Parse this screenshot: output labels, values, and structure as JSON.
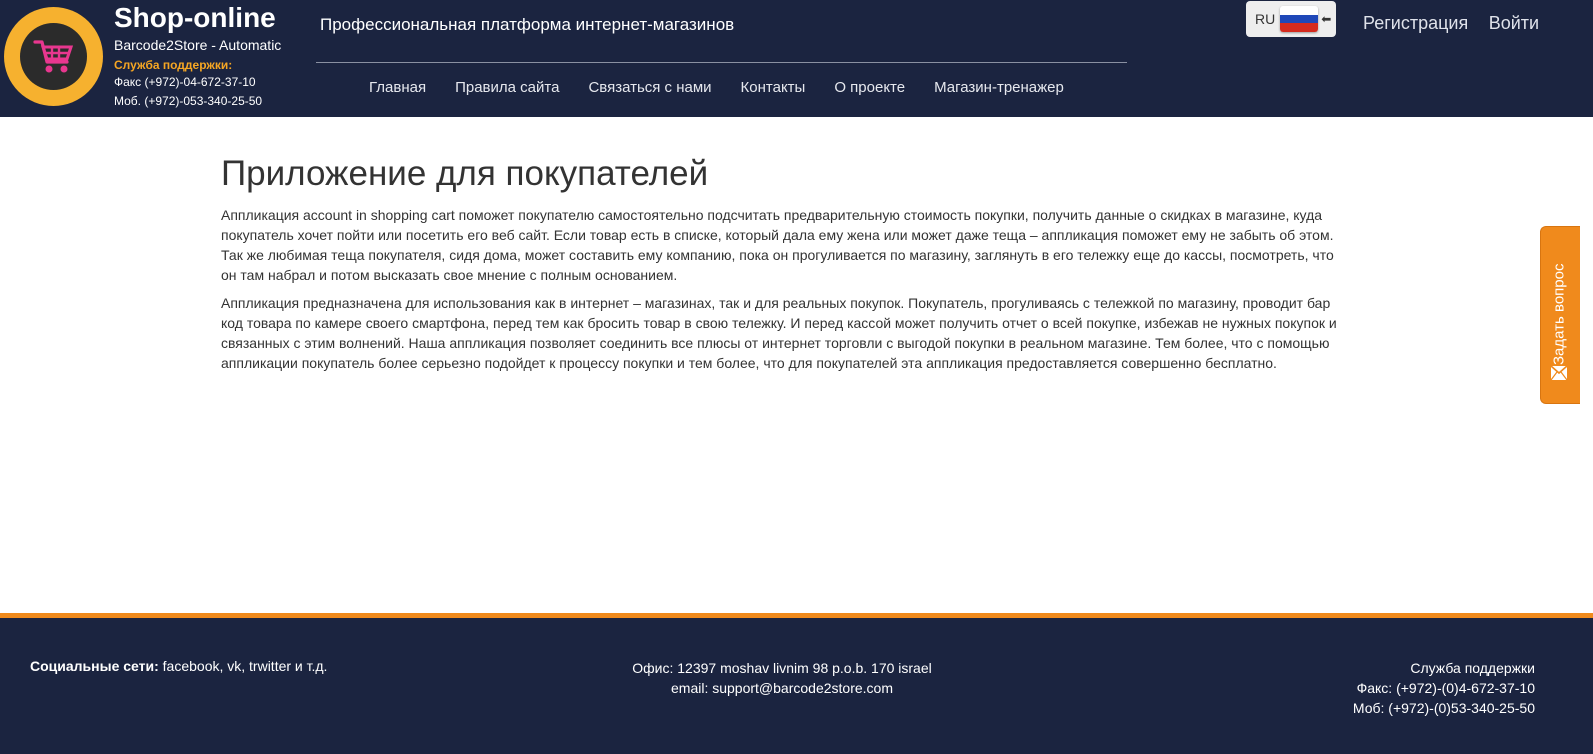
{
  "header": {
    "brand_title": "Shop-online",
    "brand_subtitle": "Barcode2Store - Automatic",
    "support_title": "Служба поддержки:",
    "fax": "Факс (+972)-04-672-37-10",
    "mobile": "Моб. (+972)-053-340-25-50",
    "tagline": "Профессиональная платформа интернет-магазинов",
    "logo_icon": "shopping-cart-icon",
    "colors": {
      "header_bg": "#1b2440",
      "logo_ring": "#f6b12f",
      "cart_pink": "#e8378f",
      "support_orange": "#f6a623"
    }
  },
  "nav": {
    "items": [
      {
        "label": "Главная"
      },
      {
        "label": "Правила сайта"
      },
      {
        "label": "Связаться с нами"
      },
      {
        "label": "Контакты"
      },
      {
        "label": "О проекте"
      },
      {
        "label": "Магазин-тренажер"
      }
    ]
  },
  "language": {
    "code": "RU",
    "flag_icon": "russia-flag-icon",
    "arrow_icon": "arrow-left-icon"
  },
  "auth": {
    "register_label": "Регистрация",
    "login_label": "Войти"
  },
  "main": {
    "title": "Приложение для покупателей",
    "paragraph_1": "Аппликация account in shopping cart поможет покупателю самостоятельно подсчитать предварительную стоимость покупки, получить данные о скидках в магазине, куда покупатель хочет пойти или посетить его веб сайт. Если товар есть в списке, который дала ему жена или может даже теща – аппликация поможет ему не забыть об этом. Так же любимая теща покупателя, сидя дома, может составить ему компанию, пока он прогуливается по магазину, заглянуть в его тележку еще до кассы, посмотреть, что он там набрал и потом высказать свое мнение с полным основанием.",
    "paragraph_2": "Аппликация предназначена для использования как в интернет – магазинах, так и для реальных покупок. Покупатель, прогуливаясь с тележкой по магазину, проводит бар код товара по камере своего смартфона, перед тем как бросить товар в свою тележку. И перед кассой может получить отчет о всей покупке, избежав не нужных покупок и связанных с этим волнений. Наша аппликация позволяет соединить все плюсы от интернет торговли с выгодой покупки в реальном магазине. Тем более, что с помощью аппликации покупатель более серьезно подойдет к процессу покупки и тем более, что для покупателей эта аппликация предоставляется совершенно бесплатно."
  },
  "side_tab": {
    "label": "Задать вопрос",
    "icon": "envelope-icon",
    "color": "#f08a1c"
  },
  "footer": {
    "social_label": "Социальные сети:",
    "social_text": "facebook, vk, trwitter и т.д.",
    "office": "Офис: 12397 moshav livnim 98 p.o.b. 170 israel",
    "email": "email: support@barcode2store.com",
    "support_title": "Служба поддержки",
    "fax": "Факс: (+972)-(0)4-672-37-10",
    "mobile": "Моб: (+972)-(0)53-340-25-50",
    "accent_color": "#f08a1c"
  }
}
